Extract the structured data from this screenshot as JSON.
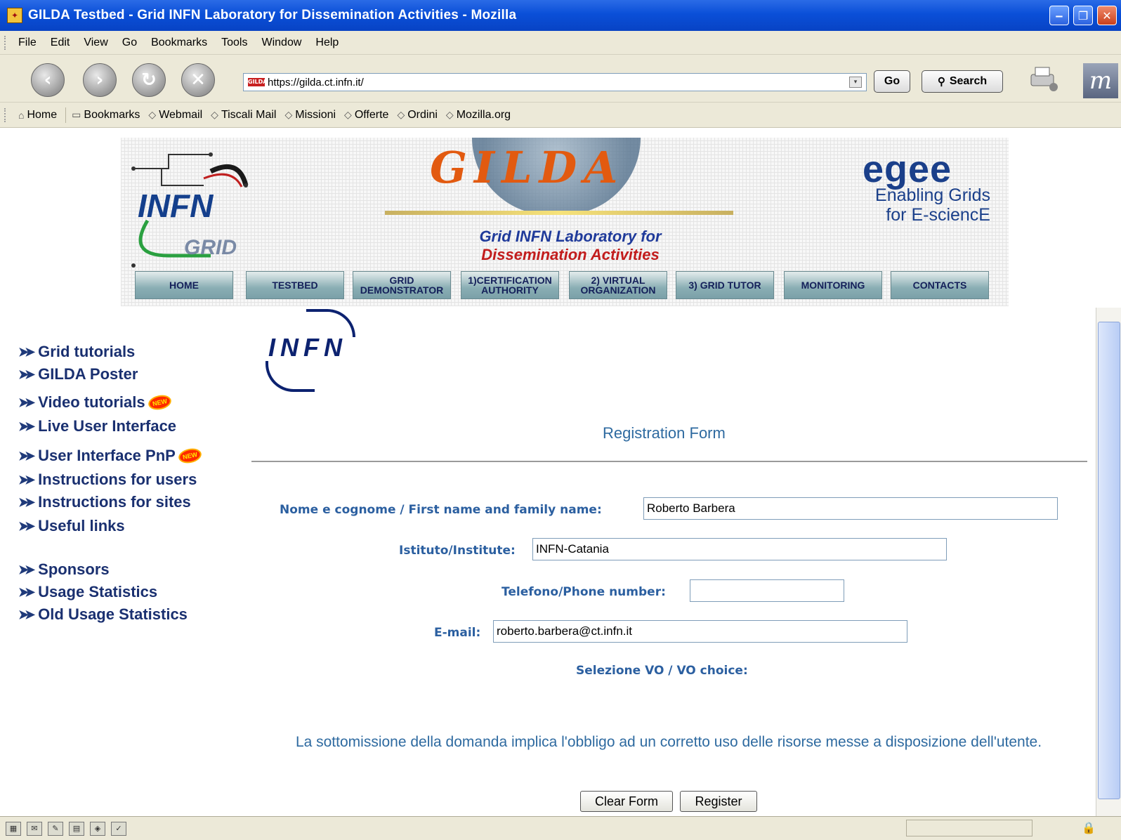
{
  "window": {
    "title": "GILDA Testbed - Grid INFN Laboratory for Dissemination Activities - Mozilla",
    "icon": "gilda-favicon",
    "buttons": [
      "minimize",
      "maximize",
      "close"
    ]
  },
  "menubar": {
    "items": [
      "File",
      "Edit",
      "View",
      "Go",
      "Bookmarks",
      "Tools",
      "Window",
      "Help"
    ]
  },
  "navbar": {
    "back_icon": "back-arrow-icon",
    "forward_icon": "forward-arrow-icon",
    "reload_icon": "reload-icon",
    "stop_icon": "stop-icon",
    "url": "https://gilda.ct.infn.it/",
    "url_favicon": "GILDA",
    "go_label": "Go",
    "search_label": "Search"
  },
  "bookmarks": {
    "items": [
      "Home",
      "Bookmarks",
      "Webmail",
      "Tiscali Mail",
      "Missioni",
      "Offerte",
      "Ordini",
      "Mozilla.org"
    ]
  },
  "banner": {
    "infn": "INFN",
    "grid": "GRID",
    "gilda": "GILDA",
    "subtitle_line1": "Grid INFN Laboratory for",
    "subtitle_line2": "Dissemination Activities",
    "egee": "egee",
    "egee_line1": "Enabling Grids",
    "egee_line2": "for E-sciencE"
  },
  "tabs": [
    {
      "label": "HOME"
    },
    {
      "label": "TESTBED"
    },
    {
      "label": "GRID DEMONSTRATOR"
    },
    {
      "label": "1)CERTIFICATION AUTHORITY"
    },
    {
      "label": "2) VIRTUAL ORGANIZATION"
    },
    {
      "label": "3) GRID TUTOR"
    },
    {
      "label": "MONITORING"
    },
    {
      "label": "CONTACTS"
    }
  ],
  "leftmenu": {
    "items": [
      {
        "label": "Grid tutorials",
        "new": false
      },
      {
        "label": "GILDA Poster",
        "new": false
      },
      {
        "label": "Video tutorials",
        "new": true
      },
      {
        "label": "Live User Interface",
        "new": false
      },
      {
        "label": "User Interface PnP",
        "new": true
      },
      {
        "label": "Instructions for users",
        "new": false
      },
      {
        "label": "Instructions for sites",
        "new": false
      },
      {
        "label": "Useful links",
        "new": false
      },
      {
        "label": "Sponsors",
        "new": false
      },
      {
        "label": "Usage Statistics",
        "new": false
      },
      {
        "label": "Old Usage Statistics",
        "new": false
      }
    ],
    "new_badge": "NEW"
  },
  "content": {
    "logo": "INFN",
    "form_title": "Registration Form",
    "fields": {
      "name_label": "Nome e cognome / First name and family name:",
      "name_value": "Roberto Barbera",
      "institute_label": "Istituto/Institute:",
      "institute_value": "INFN-Catania",
      "phone_label": "Telefono/Phone number:",
      "phone_value": "",
      "email_label": "E-mail:",
      "email_value": "roberto.barbera@ct.infn.it",
      "vo_label": "Selezione VO / VO choice:"
    },
    "disclaimer": "La sottomissione della domanda implica l'obbligo ad un corretto uso delle risorse messe a disposizione dell'utente.",
    "clear_label": "Clear Form",
    "register_label": "Register"
  },
  "colors": {
    "titlebar": "#0a4fd8",
    "menu_text": "#1a3070",
    "form_label": "#2b5fa0",
    "form_title": "#2e6aa0"
  }
}
